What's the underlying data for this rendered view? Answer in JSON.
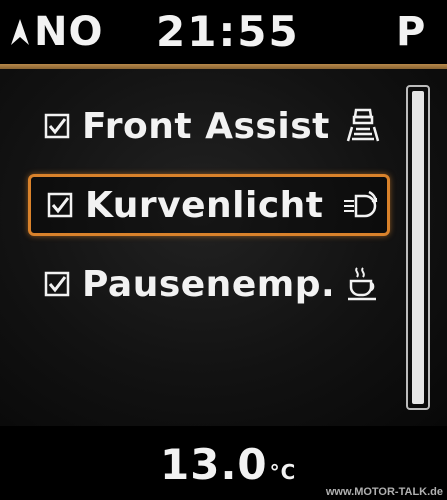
{
  "status_bar": {
    "compass_heading": "NO",
    "time": "21:55",
    "gear": "P"
  },
  "menu": {
    "items": [
      {
        "label": "Front Assist",
        "checked": true,
        "icon": "front-assist-icon",
        "selected": false
      },
      {
        "label": "Kurvenlicht",
        "checked": true,
        "icon": "curve-light-icon",
        "selected": true
      },
      {
        "label": "Pausenemp.",
        "checked": true,
        "icon": "coffee-cup-icon",
        "selected": false
      }
    ]
  },
  "bottom_bar": {
    "temperature": "13.0",
    "unit": "°C"
  },
  "watermark": "www.MOTOR-TALK.de",
  "colors": {
    "accent_rule": "#b7884a",
    "selection_border": "#d9822b",
    "text": "#f2f2f2",
    "background": "#050505"
  }
}
